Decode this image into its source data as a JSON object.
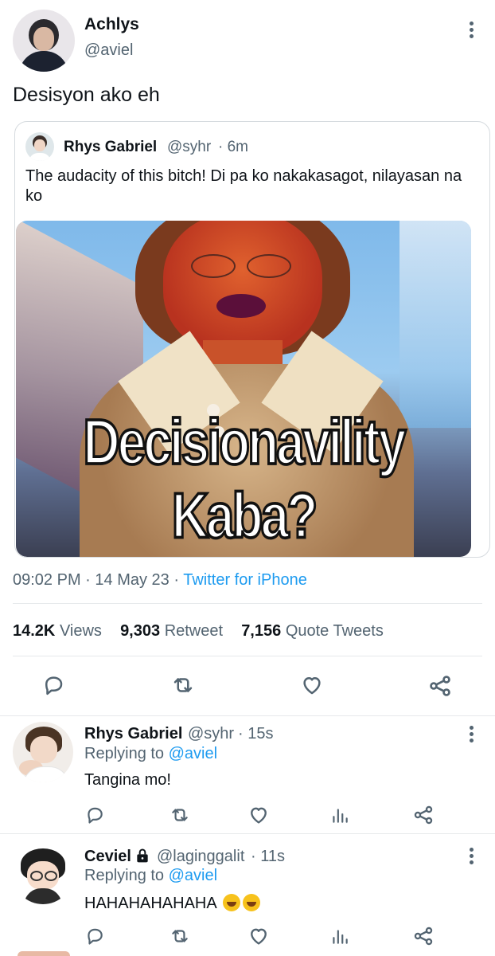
{
  "main_tweet": {
    "author_name": "Achlys",
    "author_handle": "@aviel",
    "text": "Desisyon ako eh",
    "quoted": {
      "author_name": "Rhys Gabriel",
      "author_handle": "@syhr",
      "time": "· 6m",
      "text": "The audacity of this bitch! Di pa ko nakakasagot, nilayasan na ko",
      "image_caption": "Decisionavility Kaba?"
    },
    "time": "09:02 PM",
    "date": "· 14 May 23 ·",
    "source": "Twitter for iPhone",
    "stats": {
      "views_count": "14.2K",
      "views_label": "Views",
      "retweets_count": "9,303",
      "retweets_label": "Retweet",
      "quotes_count": "7,156",
      "quotes_label": "Quote Tweets"
    }
  },
  "replies": [
    {
      "author_name": "Rhys Gabriel",
      "author_handle": "@syhr",
      "time": "· 15s",
      "replying_prefix": "Replying to",
      "replying_handle": "@aviel",
      "text": "Tangina mo!"
    },
    {
      "author_name": "Ceviel",
      "author_handle": "@laginggalit",
      "time": "· 11s",
      "replying_prefix": "Replying to",
      "replying_handle": "@aviel",
      "text": "HAHAHAHAHAHA"
    }
  ],
  "colors": {
    "accent": "#1d9bf0",
    "muted": "#536471",
    "text": "#0f1419"
  },
  "icons": [
    "more-icon",
    "reply-icon",
    "retweet-icon",
    "like-icon",
    "share-icon",
    "views-icon",
    "lock-icon",
    "laughing-emoji"
  ]
}
